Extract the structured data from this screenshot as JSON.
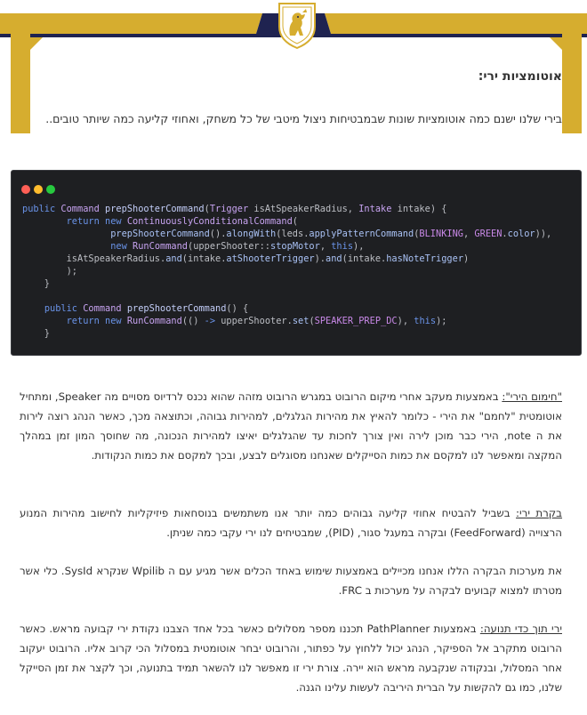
{
  "header": {
    "logo_icon": "lion-crest-icon",
    "colors": {
      "gold": "#d6ad2f",
      "navy": "#1f2350"
    }
  },
  "section_title": "אוטומציות ירי:",
  "intro": "בירי שלנו ישנם כמה אוטומציות שונות שבמבטיחות ניצול מיטבי של כל משחק, ואחוזי קליעה כמה שיותר טובים..",
  "code_window": {
    "window_dots": [
      "#ff5f56",
      "#ffbd2e",
      "#27c93f"
    ]
  },
  "paragraphs": [
    {
      "lead": "\"חימום הירי\":",
      "text": " באמצעות מעקב אחרי מיקום הרובוט במגרש הרובוט מזהה שהוא נכנס לרדיוס מסויים מה Speaker, ומתחיל אוטומטית \"לחמם\" את הירי - כלומר להאיץ את מהירות הגלגלים, למהירות גבוהה, וכתוצאה מכך, כאשר הנהג רוצה לירות את ה note, הירי כבר מוכן לירה ואין צורך לחכות עד שהגלגלים יאיצו למהירות הנכונה, מה שחוסך המון זמן במהלך המקצה ומאפשר לנו למקסם את כמות הסייקלים שאנחנו מסוגלים לבצע, ובכך למקסם את כמות הנקודות."
    },
    {
      "lead": "בקרת ירי:",
      "text": " בשביל להבטיח אחוזי קליעה גבוהים כמה יותר אנו משתמשים בנוסחאות פיזיקליות לחישוב מהירות המנוע הרצוייה (FeedForward) ובקרה במעגל סגור, (PID), שמבטיחים לנו ירי עקבי כמה שניתן."
    },
    {
      "lead": "",
      "text": "את מערכות הבקרה הללו אנחנו מכיילים באמצעות שימוש באחד הכלים אשר מגיע עם ה Wpilib שנקרא SysId. כלי אשר מטרתו למצוא קבועים לבקרה על מערכות ב FRC."
    },
    {
      "lead": "ירי תוך כדי תנועה:",
      "text": " באמצעות PathPlanner תכננו מספר מסלולים כאשר בכל אחד הצבנו נקודת ירי קבועה מראש. כאשר הרובוט מתקרב אל הספיקר, הנהג יכול ללחוץ על כפתור, והרובוט יבחר אוטומטית במסלול הכי קרוב אליו. הרובוט יעקוב אחר המסלול, ובנקודה שנקבעה מראש הוא יירה. צורת ירי זו מאפשר לנו להשאר תמיד בתנועה, וכך לקצר את זמן הסייקל שלנו, כמו גם להקשות על הברית היריבה לעשות עלינו הגנה."
    }
  ]
}
